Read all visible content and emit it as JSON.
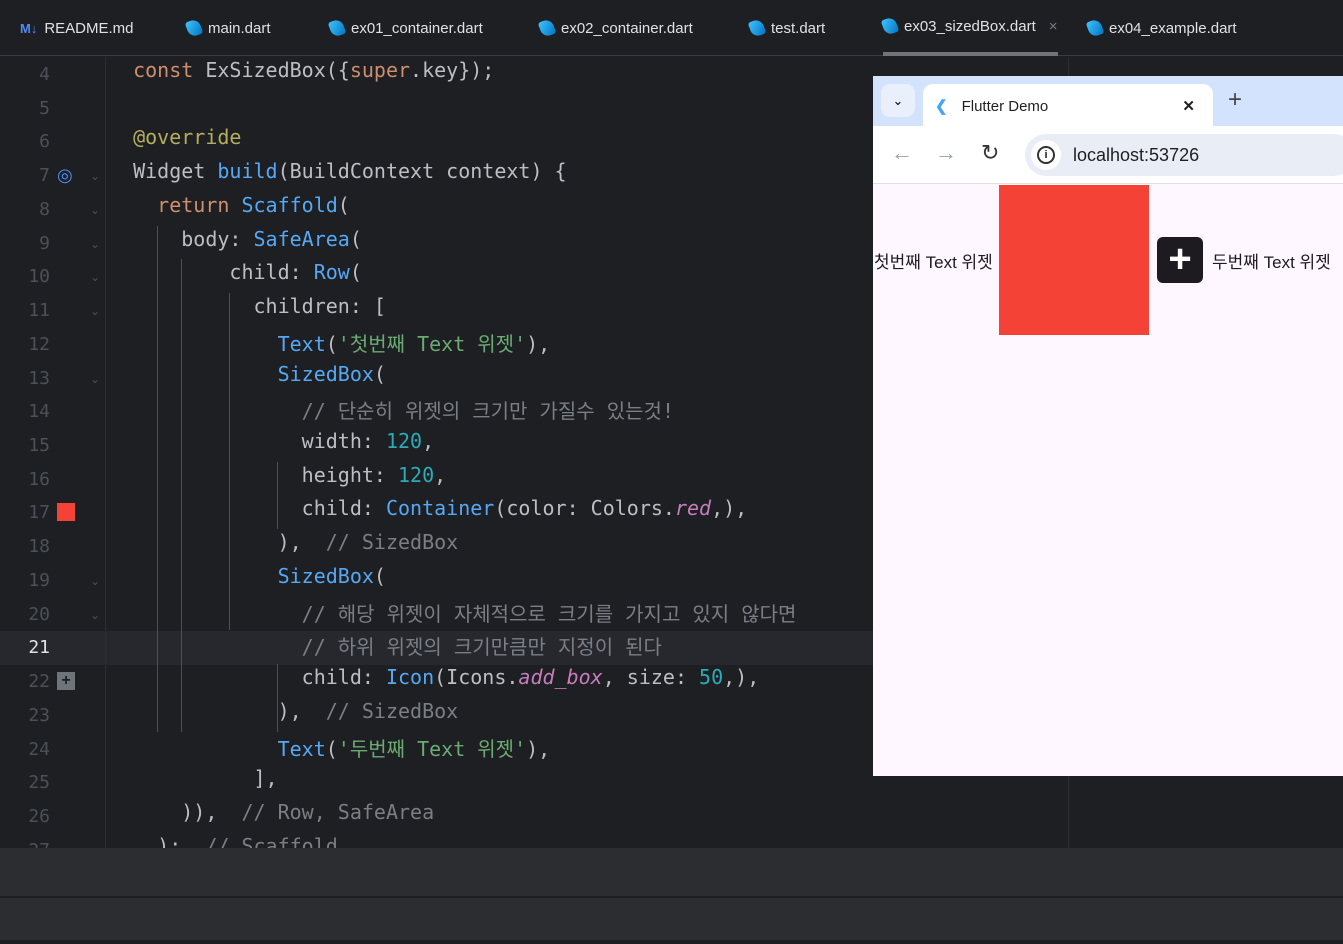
{
  "tabs": [
    {
      "label": "README.md",
      "icon": "markdown-icon",
      "icon_text": "M↓"
    },
    {
      "label": "main.dart",
      "icon": "dart-icon"
    },
    {
      "label": "ex01_container.dart",
      "icon": "dart-icon"
    },
    {
      "label": "ex02_container.dart",
      "icon": "dart-icon"
    },
    {
      "label": "test.dart",
      "icon": "dart-icon"
    },
    {
      "label": "ex03_sizedBox.dart",
      "icon": "dart-icon",
      "active": true,
      "close": "×"
    },
    {
      "label": "ex04_example.dart",
      "icon": "dart-icon"
    }
  ],
  "editor": {
    "current_line": 21,
    "lines": [
      {
        "n": "4",
        "t": [
          [
            "  const ",
            "k"
          ],
          [
            "ExSizedBox({",
            "p"
          ],
          [
            "super",
            "k"
          ],
          [
            ".key});",
            "p"
          ]
        ]
      },
      {
        "n": "5",
        "t": []
      },
      {
        "n": "6",
        "t": [
          [
            "  @override",
            "a"
          ]
        ]
      },
      {
        "n": "7",
        "t": [
          [
            "  Widget ",
            "p"
          ],
          [
            "build",
            "c"
          ],
          [
            "(BuildContext context) {",
            "p"
          ]
        ]
      },
      {
        "n": "8",
        "t": [
          [
            "    return ",
            "k"
          ],
          [
            "Scaffold",
            "c"
          ],
          [
            "(",
            "p"
          ]
        ]
      },
      {
        "n": "9",
        "t": [
          [
            "      body: ",
            "p"
          ],
          [
            "SafeArea",
            "c"
          ],
          [
            "(",
            "p"
          ]
        ]
      },
      {
        "n": "10",
        "t": [
          [
            "          child: ",
            "p"
          ],
          [
            "Row",
            "c"
          ],
          [
            "(",
            "p"
          ]
        ]
      },
      {
        "n": "11",
        "t": [
          [
            "            children: [",
            "p"
          ]
        ]
      },
      {
        "n": "12",
        "t": [
          [
            "              ",
            "p"
          ],
          [
            "Text",
            "c"
          ],
          [
            "(",
            "p"
          ],
          [
            "'첫번째 Text 위젯'",
            "s"
          ],
          [
            "),",
            "p"
          ]
        ]
      },
      {
        "n": "13",
        "t": [
          [
            "              ",
            "p"
          ],
          [
            "SizedBox",
            "c"
          ],
          [
            "(",
            "p"
          ]
        ]
      },
      {
        "n": "14",
        "t": [
          [
            "                // 단순히 위젯의 크기만 가질수 있는것!",
            "m"
          ]
        ]
      },
      {
        "n": "15",
        "t": [
          [
            "                width: ",
            "p"
          ],
          [
            "120",
            "n"
          ],
          [
            ",",
            "p"
          ]
        ]
      },
      {
        "n": "16",
        "t": [
          [
            "                height: ",
            "p"
          ],
          [
            "120",
            "n"
          ],
          [
            ",",
            "p"
          ]
        ]
      },
      {
        "n": "17",
        "t": [
          [
            "                child: ",
            "p"
          ],
          [
            "Container",
            "c"
          ],
          [
            "(color: Colors.",
            "p"
          ],
          [
            "red",
            "i"
          ],
          [
            ",),",
            "p"
          ]
        ]
      },
      {
        "n": "18",
        "t": [
          [
            "              ),  ",
            "p"
          ],
          [
            "// SizedBox",
            "m"
          ]
        ]
      },
      {
        "n": "19",
        "t": [
          [
            "              ",
            "p"
          ],
          [
            "SizedBox",
            "c"
          ],
          [
            "(",
            "p"
          ]
        ]
      },
      {
        "n": "20",
        "t": [
          [
            "                // 해당 위젯이 자체적으로 크기를 가지고 있지 않다면",
            "m"
          ]
        ]
      },
      {
        "n": "21",
        "t": [
          [
            "                // 하위 위젯의 크기만큼만 지정이 된다",
            "m"
          ]
        ]
      },
      {
        "n": "22",
        "t": [
          [
            "                child: ",
            "p"
          ],
          [
            "Icon",
            "c"
          ],
          [
            "(Icons.",
            "p"
          ],
          [
            "add_box",
            "i"
          ],
          [
            ", size: ",
            "p"
          ],
          [
            "50",
            "n"
          ],
          [
            ",),",
            "p"
          ]
        ]
      },
      {
        "n": "23",
        "t": [
          [
            "              ),  ",
            "p"
          ],
          [
            "// SizedBox",
            "m"
          ]
        ]
      },
      {
        "n": "24",
        "t": [
          [
            "              ",
            "p"
          ],
          [
            "Text",
            "c"
          ],
          [
            "(",
            "p"
          ],
          [
            "'두번째 Text 위젯'",
            "s"
          ],
          [
            "),",
            "p"
          ]
        ]
      },
      {
        "n": "25",
        "t": [
          [
            "            ],",
            "p"
          ]
        ]
      },
      {
        "n": "26",
        "t": [
          [
            "      )),  ",
            "p"
          ],
          [
            "// Row, SafeArea",
            "m"
          ]
        ]
      },
      {
        "n": "27",
        "t": [
          [
            "    );  ",
            "p"
          ],
          [
            "// Scaffold",
            "m"
          ]
        ]
      }
    ]
  },
  "browser": {
    "tab_title": "Flutter Demo",
    "tab_close": "✕",
    "new_tab": "+",
    "url": "localhost:53726",
    "app": {
      "text1": "첫번째 Text 위젯",
      "text2": "두번째 Text 위젯",
      "box_color": "#f44336",
      "icon": "add-box-icon"
    }
  }
}
